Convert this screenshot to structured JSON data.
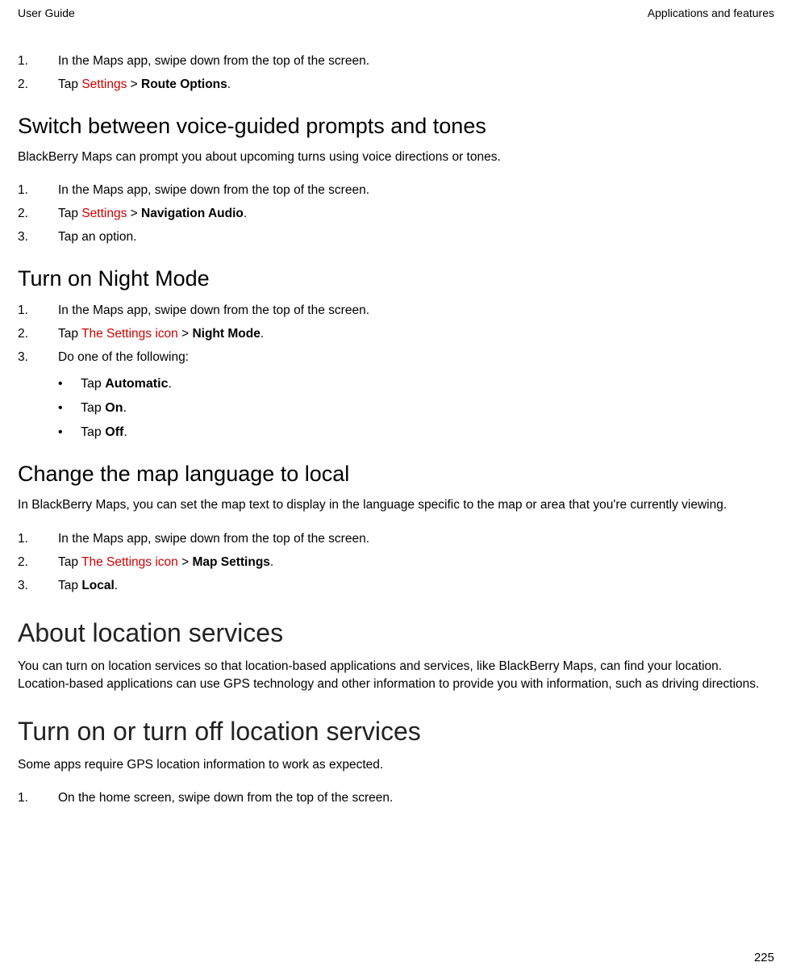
{
  "header": {
    "left": "User Guide",
    "right": "Applications and features"
  },
  "topSteps": {
    "n1": "1.",
    "s1": "In the Maps app, swipe down from the top of the screen.",
    "n2": "2.",
    "s2a": "Tap  ",
    "s2link": "Settings",
    "s2b": "  > ",
    "s2bold": "Route Options",
    "s2c": "."
  },
  "voice": {
    "heading": "Switch between voice-guided prompts and tones",
    "intro": "BlackBerry Maps can prompt you about upcoming turns using voice directions or tones.",
    "n1": "1.",
    "s1": "In the Maps app, swipe down from the top of the screen.",
    "n2": "2.",
    "s2a": "Tap  ",
    "s2link": "Settings",
    "s2b": "  > ",
    "s2bold": "Navigation Audio",
    "s2c": ".",
    "n3": "3.",
    "s3": "Tap an option."
  },
  "night": {
    "heading": "Turn on Night Mode",
    "n1": "1.",
    "s1": "In the Maps app, swipe down from the top of the screen.",
    "n2": "2.",
    "s2a": "Tap  ",
    "s2link": "The Settings icon",
    "s2b": "  > ",
    "s2bold": "Night Mode",
    "s2c": ".",
    "n3": "3.",
    "s3": "Do one of the following:",
    "b1a": "Tap ",
    "b1b": "Automatic",
    "b1c": ".",
    "b2a": "Tap ",
    "b2b": "On",
    "b2c": ".",
    "b3a": "Tap ",
    "b3b": "Off",
    "b3c": "."
  },
  "lang": {
    "heading": "Change the map language to local",
    "intro": "In BlackBerry Maps, you can set the map text to display in the language specific to the map or area that you're currently viewing.",
    "n1": "1.",
    "s1": "In the Maps app, swipe down from the top of the screen.",
    "n2": "2.",
    "s2a": "Tap  ",
    "s2link": "The Settings icon",
    "s2b": "  > ",
    "s2bold": "Map Settings",
    "s2c": ".",
    "n3": "3.",
    "s3a": "Tap ",
    "s3b": "Local",
    "s3c": "."
  },
  "about": {
    "heading": "About location services",
    "intro": "You can turn on location services so that location-based applications and services, like BlackBerry Maps, can find your location. Location-based applications can use GPS technology and other information to provide you with information, such as driving directions."
  },
  "turn": {
    "heading": "Turn on or turn off location services",
    "intro": "Some apps require GPS location information to work as expected.",
    "n1": "1.",
    "s1": "On the home screen, swipe down from the top of the screen."
  },
  "pageNumber": "225",
  "bullets": {
    "dot": "•"
  }
}
